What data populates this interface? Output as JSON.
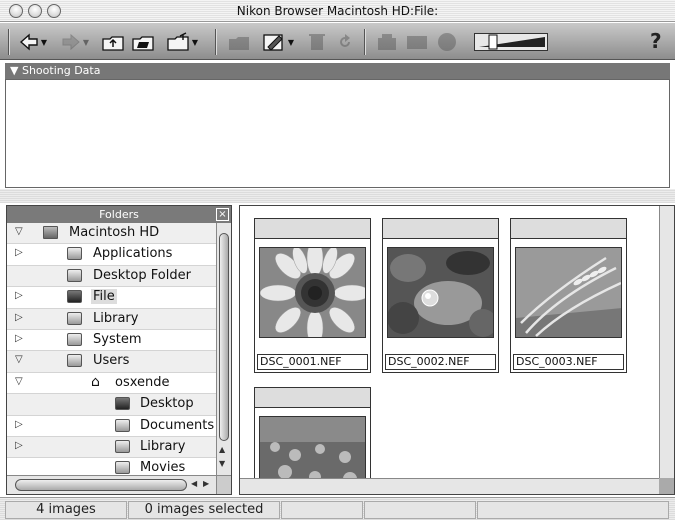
{
  "window": {
    "title": "Nikon Browser Macintosh HD:File:"
  },
  "toolbar": {
    "icons": [
      "back-arrow",
      "forward-arrow",
      "folder-up",
      "folder-open",
      "folder-new",
      "folder-dim",
      "pencil-edit",
      "trash-dim",
      "rotate-dim",
      "print-dim",
      "rect-dim",
      "circle-dim",
      "thumbnail-size-slider",
      "help"
    ],
    "help_label": "?"
  },
  "shooting_data": {
    "header": "Shooting Data"
  },
  "folders": {
    "header": "Folders",
    "close_label": "×",
    "items": [
      {
        "label": "Macintosh HD",
        "expand": "open",
        "icon": "disk-icon",
        "level": 0
      },
      {
        "label": "Applications",
        "expand": "closed",
        "icon": "folder-icon",
        "level": 1
      },
      {
        "label": "Desktop Folder",
        "expand": "none",
        "icon": "folder-icon",
        "level": 1
      },
      {
        "label": "File",
        "expand": "closed",
        "icon": "dark-folder-icon",
        "level": 1,
        "selected": true
      },
      {
        "label": "Library",
        "expand": "closed",
        "icon": "folder-icon",
        "level": 1
      },
      {
        "label": "System",
        "expand": "closed",
        "icon": "folder-icon",
        "level": 1
      },
      {
        "label": "Users",
        "expand": "open",
        "icon": "folder-icon",
        "level": 1
      },
      {
        "label": "osxende",
        "expand": "open",
        "icon": "home-icon",
        "level": 2
      },
      {
        "label": "Desktop",
        "expand": "none",
        "icon": "desktop-icon",
        "level": 3
      },
      {
        "label": "Documents",
        "expand": "closed",
        "icon": "folder-icon",
        "level": 3
      },
      {
        "label": "Library",
        "expand": "closed",
        "icon": "folder-icon",
        "level": 3
      },
      {
        "label": "Movies",
        "expand": "none",
        "icon": "folder-icon",
        "level": 3
      }
    ]
  },
  "thumbnails": [
    {
      "filename": "DSC_0001.NEF",
      "subject": "sunflower"
    },
    {
      "filename": "DSC_0002.NEF",
      "subject": "water-drop-leaf"
    },
    {
      "filename": "DSC_0003.NEF",
      "subject": "wheat"
    },
    {
      "filename": "",
      "subject": "flower-field"
    }
  ],
  "status": {
    "image_count": "4 images",
    "selected_count": "0 images selected"
  }
}
